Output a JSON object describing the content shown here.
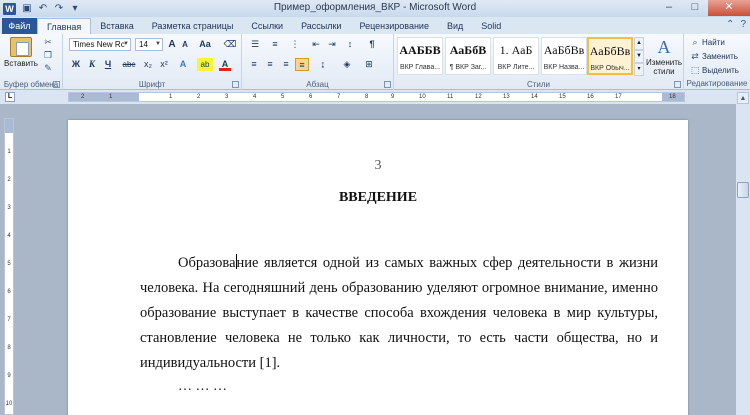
{
  "window": {
    "title": "Пример_оформления_ВКР - Microsoft Word",
    "app_logo": "W",
    "qat": [
      "save-icon",
      "undo-icon",
      "redo-icon",
      "customize-icon"
    ]
  },
  "tabs": [
    {
      "label": "Файл"
    },
    {
      "label": "Главная"
    },
    {
      "label": "Вставка"
    },
    {
      "label": "Разметка страницы"
    },
    {
      "label": "Ссылки"
    },
    {
      "label": "Рассылки"
    },
    {
      "label": "Рецензирование"
    },
    {
      "label": "Вид"
    },
    {
      "label": "Solid"
    }
  ],
  "ribbon": {
    "clipboard": {
      "paste_label": "Вставить",
      "group_label": "Буфер обмена"
    },
    "font": {
      "font_name": "Times New Rc",
      "font_size": "14",
      "group_label": "Шрифт",
      "grow": "A",
      "shrink": "A",
      "case": "Aa",
      "bold": "Ж",
      "italic": "К",
      "underline": "Ч",
      "strike": "abc",
      "sub": "x₂",
      "sup": "x²",
      "text_effects": "A",
      "highlight": "ab",
      "font_color": "A"
    },
    "paragraph": {
      "group_label": "Абзац",
      "pilcrow": "¶"
    },
    "styles": {
      "group_label": "Стили",
      "tiles": [
        {
          "sample": "ААББВ",
          "name": "ВКР Глава..."
        },
        {
          "sample": "АаБбВ",
          "name": "¶ ВКР Заг..."
        },
        {
          "sample": "1. АаБ",
          "name": "ВКР Лите..."
        },
        {
          "sample": "АаБбВв",
          "name": "ВКР Назва..."
        },
        {
          "sample": "АаБбВв",
          "name": "ВКР Обыч..."
        }
      ],
      "change_styles": "Изменить стили"
    },
    "editing": {
      "group_label": "Редактирование",
      "find": "Найти",
      "replace": "Заменить",
      "select": "Выделить"
    }
  },
  "ruler": {
    "ticks": [
      "2",
      "1",
      "1",
      "2",
      "3",
      "4",
      "5",
      "6",
      "7",
      "8",
      "9",
      "10",
      "11",
      "12",
      "13",
      "14",
      "15",
      "16",
      "17",
      "18"
    ]
  },
  "vruler": {
    "ticks": [
      "1",
      "2",
      "3",
      "4",
      "5",
      "6",
      "7",
      "8",
      "9",
      "10"
    ]
  },
  "document": {
    "page_number": "3",
    "heading": "ВВЕДЕНИЕ",
    "text_before_caret": "Образова",
    "text_after_caret": "ние является одной из самых важных сфер деятельности в жизни человека. На сегодняшний день образованию уделяют огромное внимание, именно образование выступает в качестве способа вхождения человека в мир культуры, становление человека не только как личности, то есть части общества, но и индивидуальности [1].",
    "ellipsis": "… … …"
  }
}
